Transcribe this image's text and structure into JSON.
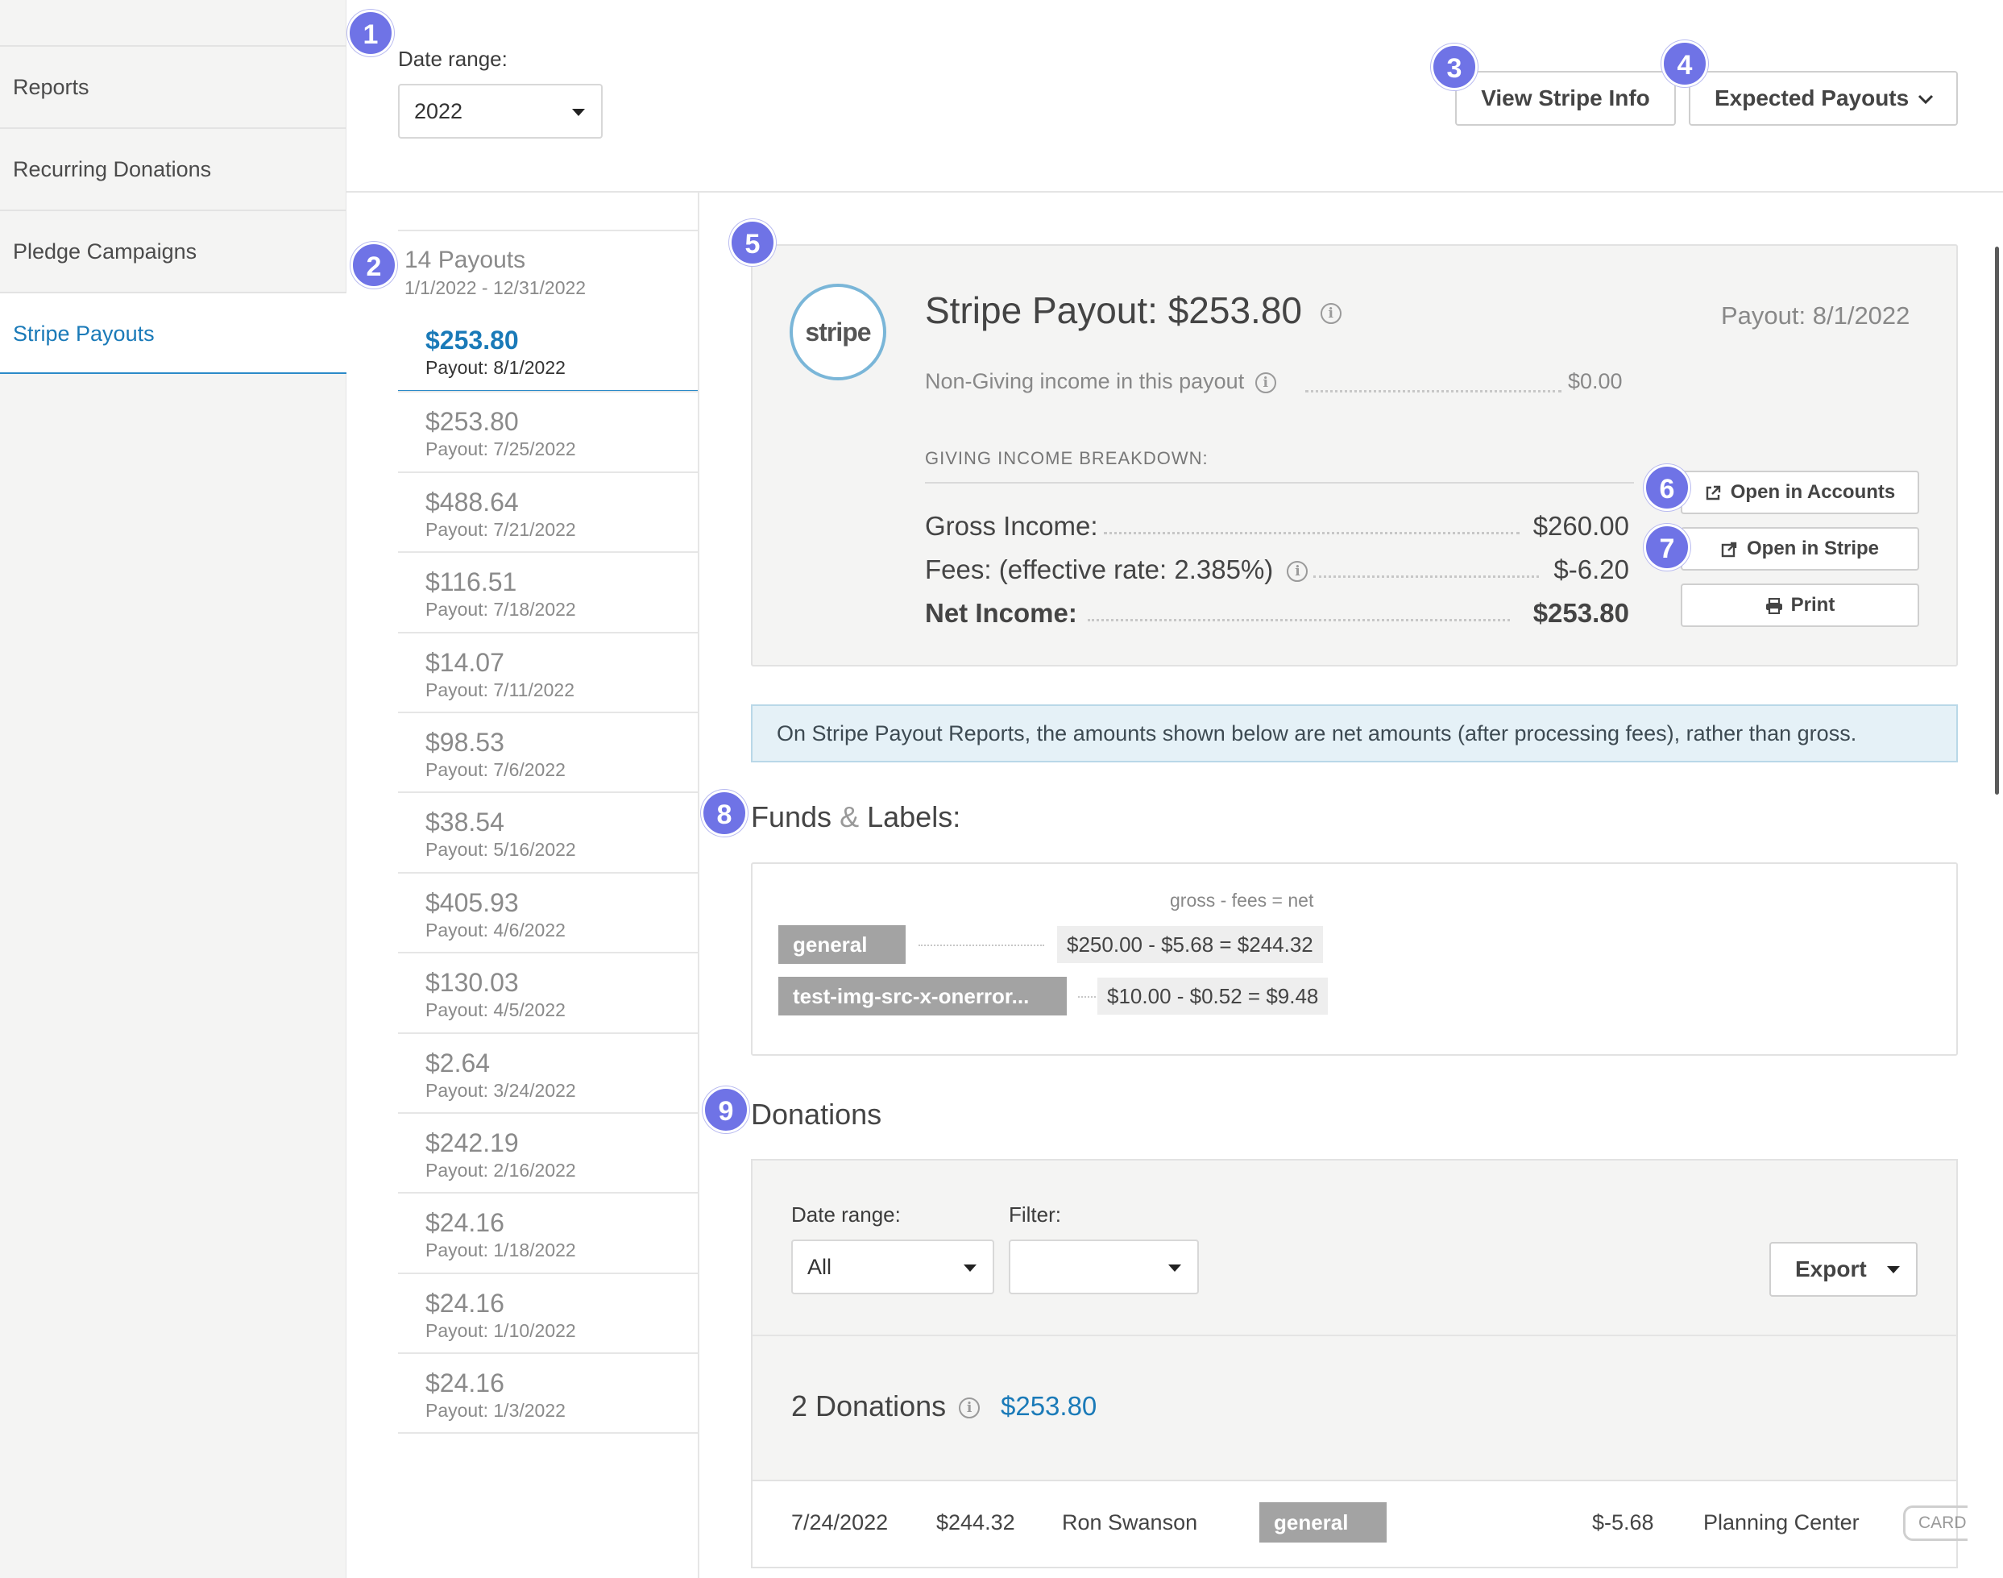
{
  "sidebar": {
    "items": [
      {
        "label": "Reports",
        "active": false
      },
      {
        "label": "Recurring Donations",
        "active": false
      },
      {
        "label": "Pledge Campaigns",
        "active": false
      },
      {
        "label": "Stripe Payouts",
        "active": true
      }
    ]
  },
  "badges": [
    "1",
    "2",
    "3",
    "4",
    "5",
    "6",
    "7",
    "8",
    "9"
  ],
  "top_filter": {
    "date_range_label": "Date range:",
    "date_range_value": "2022"
  },
  "top_actions": {
    "view_stripe_info": "View Stripe Info",
    "expected_payouts": "Expected Payouts"
  },
  "payout_list": {
    "title": "14 Payouts",
    "range": "1/1/2022 - 12/31/2022",
    "items": [
      {
        "amount": "$253.80",
        "date": "Payout: 8/1/2022",
        "active": true
      },
      {
        "amount": "$253.80",
        "date": "Payout: 7/25/2022"
      },
      {
        "amount": "$488.64",
        "date": "Payout: 7/21/2022"
      },
      {
        "amount": "$116.51",
        "date": "Payout: 7/18/2022"
      },
      {
        "amount": "$14.07",
        "date": "Payout: 7/11/2022"
      },
      {
        "amount": "$98.53",
        "date": "Payout: 7/6/2022"
      },
      {
        "amount": "$38.54",
        "date": "Payout: 5/16/2022"
      },
      {
        "amount": "$405.93",
        "date": "Payout: 4/6/2022"
      },
      {
        "amount": "$130.03",
        "date": "Payout: 4/5/2022"
      },
      {
        "amount": "$2.64",
        "date": "Payout: 3/24/2022"
      },
      {
        "amount": "$242.19",
        "date": "Payout: 2/16/2022"
      },
      {
        "amount": "$24.16",
        "date": "Payout: 1/18/2022"
      },
      {
        "amount": "$24.16",
        "date": "Payout: 1/10/2022"
      },
      {
        "amount": "$24.16",
        "date": "Payout: 1/3/2022"
      }
    ]
  },
  "summary": {
    "logo_text": "stripe",
    "title": "Stripe Payout: $253.80",
    "payout_date": "Payout: 8/1/2022",
    "non_giving_label": "Non-Giving income in this payout",
    "non_giving_value": "$0.00",
    "breakdown_label": "GIVING INCOME BREAKDOWN:",
    "gross_label": "Gross Income:",
    "gross_value": "$260.00",
    "fees_label": "Fees: (effective rate: 2.385%)",
    "fees_value": "$-6.20",
    "net_label": "Net Income:",
    "net_value": "$253.80",
    "open_accounts": "Open in Accounts",
    "open_stripe": "Open in Stripe",
    "print": "Print"
  },
  "alert_text": "On Stripe Payout Reports, the amounts shown below are net amounts (after processing fees), rather than gross.",
  "funds": {
    "title_a": "Funds",
    "title_amp": "&",
    "title_b": "Labels:",
    "hint": "gross - fees = net",
    "rows": [
      {
        "name": "general",
        "calc": "$250.00 - $5.68 = $244.32"
      },
      {
        "name": "test-img-src-x-onerror...",
        "calc": "$10.00 - $0.52 = $9.48"
      }
    ]
  },
  "donations": {
    "title": "Donations",
    "date_range_label": "Date range:",
    "date_range_value": "All",
    "filter_label": "Filter:",
    "filter_value": "",
    "export": "Export",
    "count_label": "2 Donations",
    "total": "$253.80",
    "rows": [
      {
        "date": "7/24/2022",
        "amount": "$244.32",
        "donor": "Ron Swanson",
        "fund": "general",
        "fee": "$-5.68",
        "source": "Planning Center",
        "method": "CARD"
      }
    ]
  },
  "colors": {
    "accent": "#1a7ab8",
    "badge": "#6f73e6",
    "fund_tag": "#a3a3a3",
    "alert_bg": "#e5f1f7"
  }
}
